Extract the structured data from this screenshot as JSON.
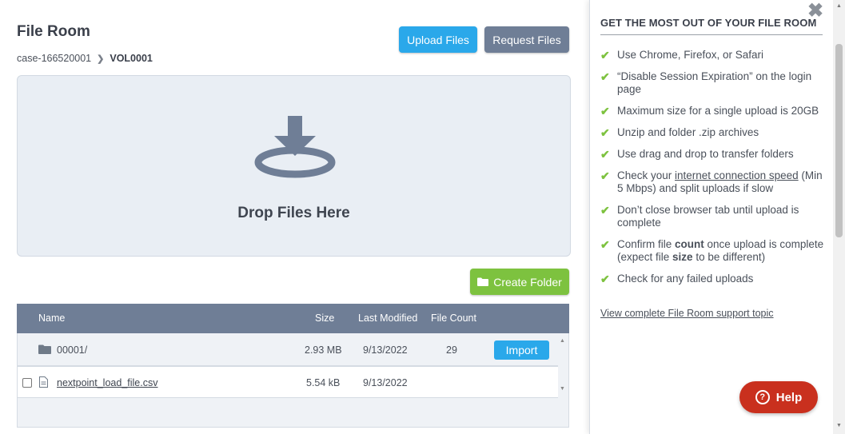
{
  "page": {
    "title": "File Room",
    "breadcrumb": {
      "parent": "case-166520001",
      "current": "VOL0001"
    }
  },
  "actions": {
    "upload_label": "Upload Files",
    "request_label": "Request Files",
    "create_folder_label": "Create Folder"
  },
  "dropzone": {
    "label": "Drop Files Here",
    "icon": "download-tray-icon"
  },
  "table": {
    "columns": {
      "name": "Name",
      "size": "Size",
      "last_modified": "Last Modified",
      "file_count": "File Count"
    },
    "rows": [
      {
        "type": "folder",
        "name": "00001/",
        "size": "2.93 MB",
        "last_modified": "9/13/2022",
        "file_count": "29",
        "action": "Import"
      },
      {
        "type": "file",
        "name": "nextpoint_load_file.csv",
        "size": "5.54 kB",
        "last_modified": "9/13/2022",
        "file_count": ""
      }
    ]
  },
  "panel": {
    "title": "GET THE MOST OUT OF YOUR FILE ROOM",
    "tips": [
      "Use Chrome, Firefox, or Safari",
      "“Disable Session Expiration” on the login page",
      "Maximum size for a single upload is 20GB",
      "Unzip and folder .zip archives",
      "Use drag and drop to transfer folders",
      {
        "pre": "Check your ",
        "link": "internet connection speed",
        "post": " (Min 5 Mbps) and split uploads if slow"
      },
      "Don’t close browser tab until upload is complete",
      {
        "pre": "Confirm file ",
        "b1": "count",
        "mid": " once upload is complete (expect file ",
        "b2": "size",
        "post": " to be different)"
      },
      "Check for any failed uploads"
    ],
    "support_link": "View complete File Room support topic",
    "help_label": "Help"
  },
  "colors": {
    "primary": "#2aa8ea",
    "secondary": "#6f7e96",
    "success": "#7dc23f",
    "danger": "#c9301e"
  }
}
